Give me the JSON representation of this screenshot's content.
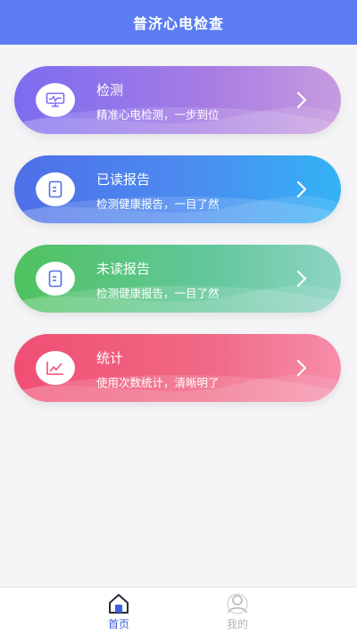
{
  "header": {
    "title": "普济心电检查"
  },
  "cards": [
    {
      "title": "检测",
      "subtitle": "精准心电检测，一步到位",
      "icon": "monitor-icon"
    },
    {
      "title": "已读报告",
      "subtitle": "检测健康报告，一目了然",
      "icon": "document-icon"
    },
    {
      "title": "未读报告",
      "subtitle": "检测健康报告，一目了然",
      "icon": "document-icon"
    },
    {
      "title": "统计",
      "subtitle": "使用次数统计，清晰明了",
      "icon": "line-chart-icon"
    }
  ],
  "tabbar": {
    "home_label": "首页",
    "mine_label": "我的",
    "active_color": "#3f5fe0",
    "inactive_color": "#b5b5b5"
  },
  "colors": {
    "header": "#5b7cf2",
    "background": "#f5f5f7"
  }
}
